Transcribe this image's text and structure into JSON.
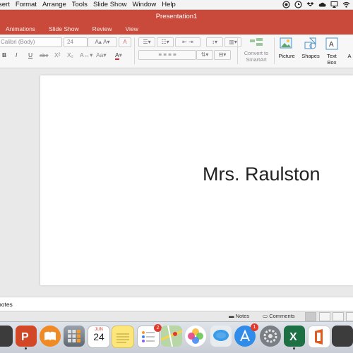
{
  "menubar": {
    "items": [
      "sert",
      "Format",
      "Arrange",
      "Tools",
      "Slide Show",
      "Window",
      "Help"
    ]
  },
  "window": {
    "title": "Presentation1"
  },
  "ribbon_tabs": [
    "Animations",
    "Slide Show",
    "Review",
    "View"
  ],
  "ribbon": {
    "font_name": "Calibri (Body)",
    "font_size": "24",
    "format_buttons": [
      "B",
      "I",
      "U",
      "abe",
      "X²",
      "X₂"
    ],
    "convert_smartart": [
      "Convert to",
      "SmartArt"
    ],
    "picture_label": "Picture",
    "shapes_label": "Shapes",
    "textbox_label": [
      "Text",
      "Box"
    ],
    "cut_label": "A"
  },
  "slide": {
    "title": "Mrs. Raulston"
  },
  "notes": {
    "placeholder": "notes"
  },
  "statusbar": {
    "notes_label": "Notes",
    "comments_label": "Comments"
  },
  "dock": {
    "calendar": {
      "month": "JUN",
      "day": "24"
    },
    "reminders_badge": "2",
    "appstore_badge": "1",
    "colors": {
      "powerpoint": "#d24726",
      "excel": "#1d7044",
      "accent": "#c94a3b"
    }
  }
}
